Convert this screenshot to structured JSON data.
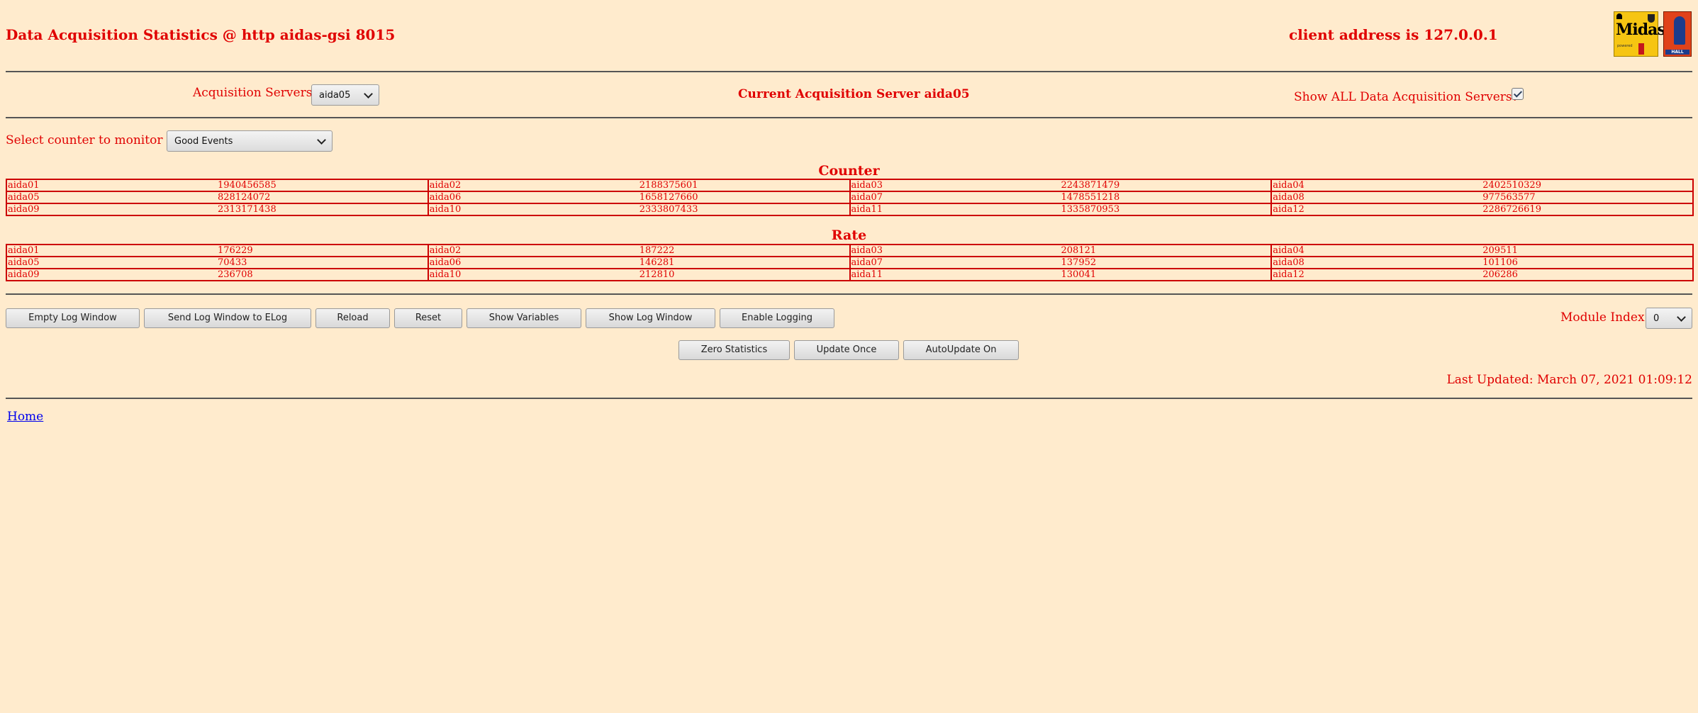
{
  "header": {
    "title": "Data Acquisition Statistics @ http aidas-gsi 8015",
    "client": "client address is 127.0.0.1",
    "logos": [
      "Midas",
      "Hall of fame"
    ]
  },
  "servers": {
    "label": "Acquisition Servers",
    "selected": "aida05",
    "current": "Current Acquisition Server aida05",
    "show_all_label": "Show ALL Data Acquisition Servers?",
    "show_all_checked": true
  },
  "counter_select": {
    "label": "Select counter to monitor",
    "selected": "Good Events"
  },
  "counter": {
    "title": "Counter",
    "rows": [
      [
        [
          "aida01",
          "1940456585"
        ],
        [
          "aida02",
          "2188375601"
        ],
        [
          "aida03",
          "2243871479"
        ],
        [
          "aida04",
          "2402510329"
        ]
      ],
      [
        [
          "aida05",
          "828124072"
        ],
        [
          "aida06",
          "1658127660"
        ],
        [
          "aida07",
          "1478551218"
        ],
        [
          "aida08",
          "977563577"
        ]
      ],
      [
        [
          "aida09",
          "2313171438"
        ],
        [
          "aida10",
          "2333807433"
        ],
        [
          "aida11",
          "1335870953"
        ],
        [
          "aida12",
          "2286726619"
        ]
      ]
    ]
  },
  "rate": {
    "title": "Rate",
    "rows": [
      [
        [
          "aida01",
          "176229"
        ],
        [
          "aida02",
          "187222"
        ],
        [
          "aida03",
          "208121"
        ],
        [
          "aida04",
          "209511"
        ]
      ],
      [
        [
          "aida05",
          "70433"
        ],
        [
          "aida06",
          "146281"
        ],
        [
          "aida07",
          "137952"
        ],
        [
          "aida08",
          "101106"
        ]
      ],
      [
        [
          "aida09",
          "236708"
        ],
        [
          "aida10",
          "212810"
        ],
        [
          "aida11",
          "130041"
        ],
        [
          "aida12",
          "206286"
        ]
      ]
    ]
  },
  "buttons": {
    "empty_log": "Empty Log Window",
    "send_log": "Send Log Window to ELog",
    "reload": "Reload",
    "reset": "Reset",
    "show_variables": "Show Variables",
    "show_log": "Show Log Window",
    "enable_logging": "Enable Logging",
    "zero_stats": "Zero Statistics",
    "update_once": "Update Once",
    "autoupdate": "AutoUpdate On"
  },
  "module": {
    "label": "Module Index",
    "selected": "0"
  },
  "footer": {
    "updated": "Last Updated: March 07, 2021 01:09:12",
    "home": "Home"
  }
}
